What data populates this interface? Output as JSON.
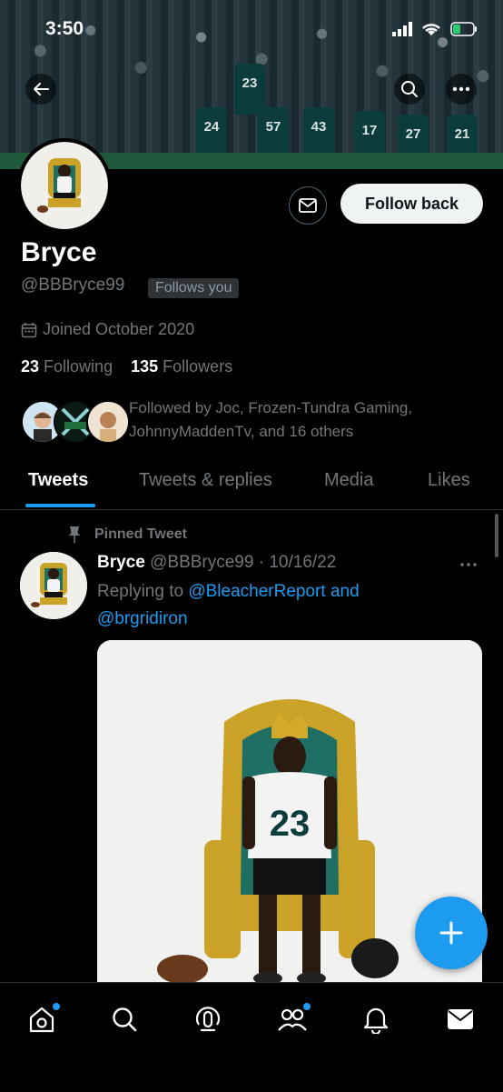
{
  "status": {
    "time": "3:50"
  },
  "profile": {
    "name": "Bryce",
    "handle": "@BBBryce99",
    "follows_you": "Follows you",
    "joined": "Joined October 2020",
    "following_count": "23",
    "following_label": "Following",
    "followers_count": "135",
    "followers_label": "Followers",
    "followed_by": "Followed by Joc, Frozen-Tundra Gaming, JohnnyMaddenTv, and 16 others",
    "follow_back_label": "Follow back"
  },
  "tabs": [
    {
      "label": "Tweets"
    },
    {
      "label": "Tweets & replies"
    },
    {
      "label": "Media"
    },
    {
      "label": "Likes"
    }
  ],
  "tweet": {
    "pinned_label": "Pinned Tweet",
    "author_name": "Bryce",
    "author_handle": "@BBBryce99",
    "date": "· 10/16/22",
    "replying_to": "Replying to",
    "mention1": "@BleacherReport",
    "and": "and",
    "mention2": "@brgridiron",
    "image_jersey_number": "23"
  },
  "banner": {
    "jerseys": [
      "24",
      "57",
      "43",
      "17",
      "27",
      "21",
      "23"
    ]
  },
  "colors": {
    "accent": "#1d9bf0",
    "background": "#000000",
    "muted_text": "#71767b",
    "eagles_green": "#0b3b3a"
  },
  "icons": {
    "back": "arrow-left-icon",
    "search": "search-icon",
    "more": "more-icon",
    "message": "envelope-icon",
    "calendar": "calendar-icon",
    "pin": "pin-icon",
    "compose": "plus-icon",
    "nav": [
      "home-icon",
      "search-icon",
      "spaces-icon",
      "communities-icon",
      "notifications-icon",
      "messages-icon"
    ]
  }
}
